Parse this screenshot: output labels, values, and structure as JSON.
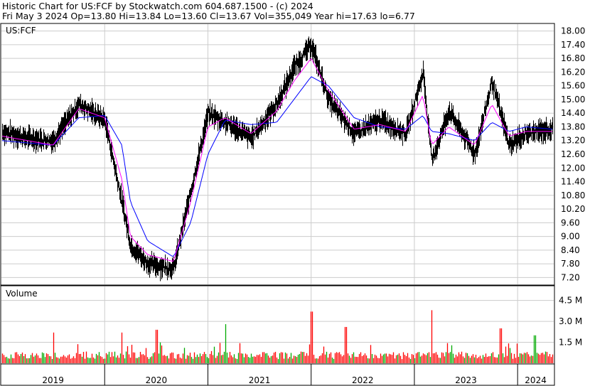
{
  "header": {
    "line1": "Historic Chart for US:FCF by Stockwatch.com 604.687.1500 - (c) 2024",
    "line2": "Fri May  3 2024   Op=13.80   Hi=13.84   Lo=13.60   Cl=13.67   Vol=355,049   Year hi=17.63   lo=6.77"
  },
  "chart_data": [
    {
      "type": "line",
      "title": "US:FCF",
      "panel": "price",
      "ylim": [
        6.9,
        18.3
      ],
      "yticks": [
        "18.00",
        "17.40",
        "16.80",
        "16.20",
        "15.60",
        "15.00",
        "14.40",
        "13.80",
        "13.20",
        "12.60",
        "12.00",
        "11.40",
        "10.80",
        "10.20",
        "9.60",
        "9.00",
        "8.40",
        "7.80",
        "7.20"
      ],
      "x": [
        "2019-01",
        "2019-04",
        "2019-07",
        "2019-10",
        "2020-01",
        "2020-03",
        "2020-04",
        "2020-06",
        "2020-09",
        "2020-11",
        "2021-01",
        "2021-03",
        "2021-06",
        "2021-09",
        "2021-11",
        "2022-01",
        "2022-03",
        "2022-06",
        "2022-09",
        "2022-12",
        "2023-02",
        "2023-03",
        "2023-05",
        "2023-08",
        "2023-10",
        "2023-12",
        "2024-02",
        "2024-05"
      ],
      "series": [
        {
          "values": [
            13.6,
            13.3,
            13.2,
            14.8,
            14.1,
            10.5,
            8.6,
            7.8,
            7.6,
            11.0,
            14.4,
            14.0,
            13.3,
            14.8,
            16.4,
            17.4,
            15.0,
            13.5,
            14.1,
            13.5,
            16.2,
            12.3,
            14.5,
            12.6,
            15.8,
            13.0,
            13.5,
            13.7
          ]
        },
        {
          "values": [
            13.4,
            13.2,
            13.0,
            14.6,
            14.2,
            11.5,
            9.0,
            8.2,
            7.9,
            10.5,
            13.8,
            14.2,
            13.5,
            14.5,
            15.8,
            16.8,
            15.4,
            13.7,
            13.9,
            13.6,
            15.2,
            13.0,
            13.8,
            13.0,
            14.8,
            13.4,
            13.6,
            13.6
          ]
        },
        {
          "values": [
            13.2,
            13.1,
            13.0,
            14.2,
            14.3,
            13.0,
            10.5,
            8.8,
            8.1,
            9.6,
            12.6,
            14.1,
            13.9,
            14.0,
            15.0,
            16.0,
            15.6,
            14.2,
            13.8,
            13.7,
            14.3,
            13.6,
            13.5,
            13.2,
            14.0,
            13.6,
            13.8,
            13.7
          ]
        }
      ]
    },
    {
      "type": "bar",
      "title": "Volume",
      "panel": "volume",
      "unit": "M",
      "ylim": [
        0,
        5.5
      ],
      "yticks": [
        "4.5 M",
        "3.0 M",
        "1.5 M"
      ],
      "x_year_labels": [
        "2019",
        "2020",
        "2021",
        "2022",
        "2023",
        "2024"
      ],
      "notable_spikes": [
        {
          "x": "2019-07",
          "value": 2.2,
          "color": "red"
        },
        {
          "x": "2020-03",
          "value": 2.2,
          "color": "red"
        },
        {
          "x": "2020-07",
          "value": 2.4,
          "color": "red"
        },
        {
          "x": "2021-03",
          "value": 2.8,
          "color": "green"
        },
        {
          "x": "2022-01",
          "value": 3.7,
          "color": "red"
        },
        {
          "x": "2022-05",
          "value": 2.6,
          "color": "red"
        },
        {
          "x": "2023-03",
          "value": 3.8,
          "color": "red"
        },
        {
          "x": "2023-11",
          "value": 2.5,
          "color": "red"
        },
        {
          "x": "2024-03",
          "value": 2.0,
          "color": "green"
        }
      ],
      "typical_value": 0.6
    }
  ],
  "colors": {
    "price_bars": "#000000",
    "ma_short": "#ff00ff",
    "ma_long": "#0000ff",
    "volume_up": "#00aa00",
    "volume_down": "#ff0000",
    "grid": "#cccccc"
  }
}
